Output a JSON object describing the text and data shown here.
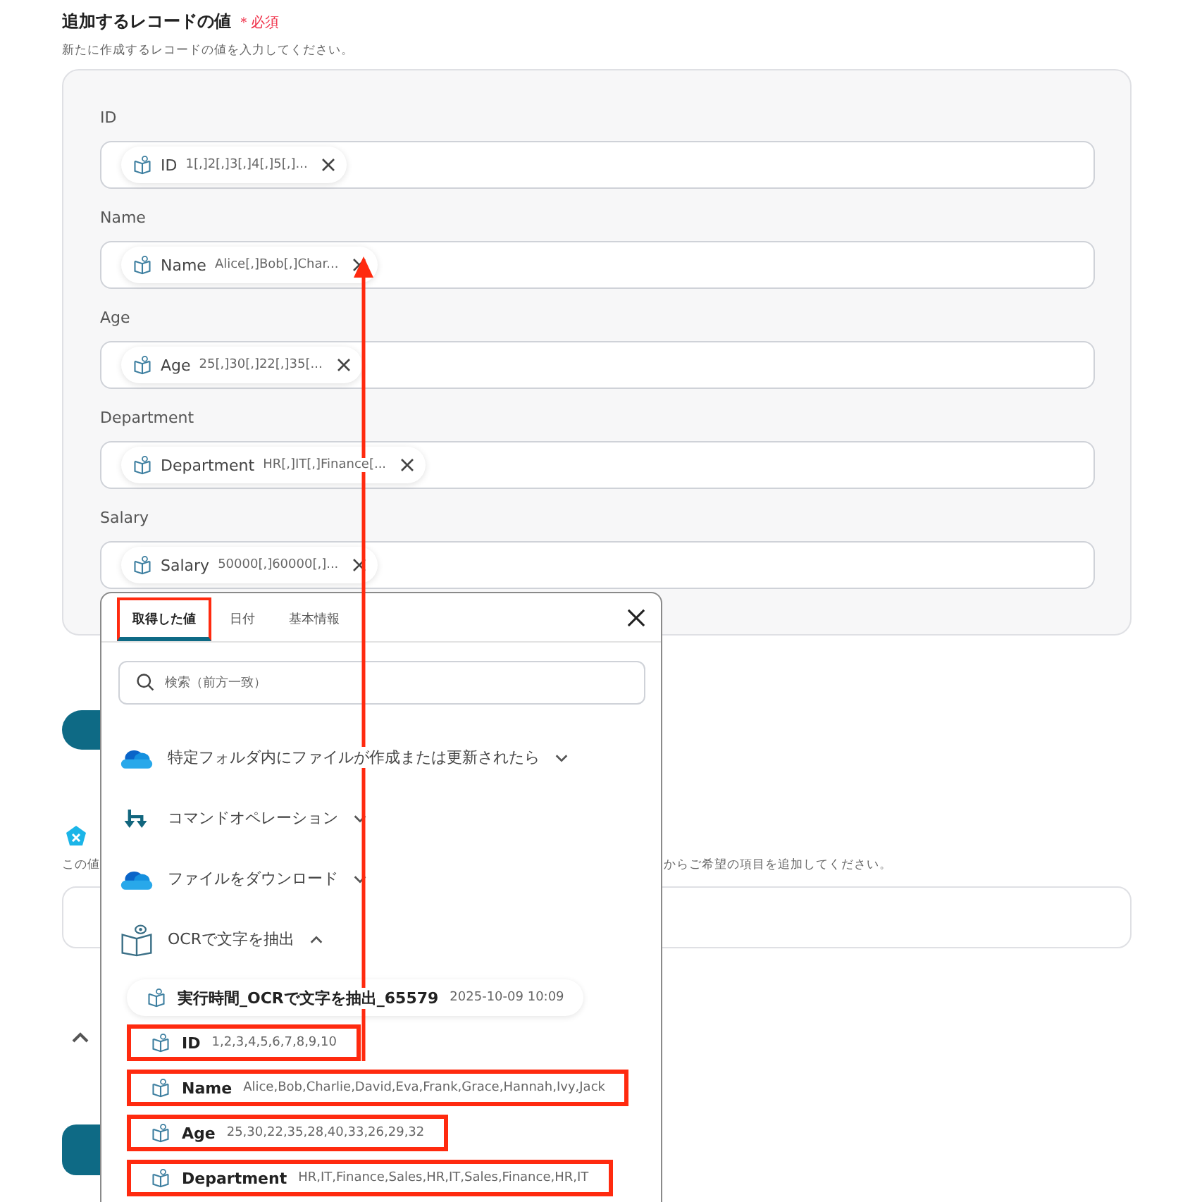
{
  "section": {
    "title": "追加するレコードの値",
    "required_mark": "＊必須",
    "description": "新たに作成するレコードの値を入力してください。"
  },
  "fields": [
    {
      "label": "ID",
      "chip": {
        "name": "ID",
        "value": "1[,]2[,]3[,]4[,]5[,]..."
      }
    },
    {
      "label": "Name",
      "chip": {
        "name": "Name",
        "value": "Alice[,]Bob[,]Char..."
      }
    },
    {
      "label": "Age",
      "chip": {
        "name": "Age",
        "value": "25[,]30[,]22[,]35[..."
      }
    },
    {
      "label": "Department",
      "chip": {
        "name": "Department",
        "value": "HR[,]IT[,]Finance[..."
      }
    },
    {
      "label": "Salary",
      "chip": {
        "name": "Salary",
        "value": "50000[,]60000[,]..."
      }
    }
  ],
  "next_section": {
    "description_start": "この値",
    "description_end": "からご希望の項目を追加してください。"
  },
  "popup": {
    "tabs": [
      {
        "label": "取得した値",
        "selected": true,
        "highlighted": true
      },
      {
        "label": "日付",
        "selected": false,
        "highlighted": false
      },
      {
        "label": "基本情報",
        "selected": false,
        "highlighted": false
      }
    ],
    "search": {
      "placeholder": "検索（前方一致）"
    },
    "groups": [
      {
        "kind": "cloud",
        "title": "特定フォルダ内にファイルが作成または更新されたら",
        "expanded": false
      },
      {
        "kind": "command",
        "title": "コマンドオペレーション",
        "expanded": false
      },
      {
        "kind": "cloud",
        "title": "ファイルをダウンロード",
        "expanded": false
      },
      {
        "kind": "ocr",
        "title": "OCRで文字を抽出",
        "expanded": true,
        "items": [
          {
            "name": "実行時間_OCRで文字を抽出_65579",
            "value": "2025-10-09 10:09",
            "highlighted": false
          },
          {
            "name": "ID",
            "value": "1,2,3,4,5,6,7,8,9,10",
            "highlighted": true
          },
          {
            "name": "Name",
            "value": "Alice,Bob,Charlie,David,Eva,Frank,Grace,Hannah,Ivy,Jack",
            "highlighted": true
          },
          {
            "name": "Age",
            "value": "25,30,22,35,28,40,33,26,29,32",
            "highlighted": true
          },
          {
            "name": "Department",
            "value": "HR,IT,Finance,Sales,HR,IT,Sales,Finance,HR,IT",
            "highlighted": true
          }
        ]
      }
    ]
  },
  "annotation_arrow": true
}
